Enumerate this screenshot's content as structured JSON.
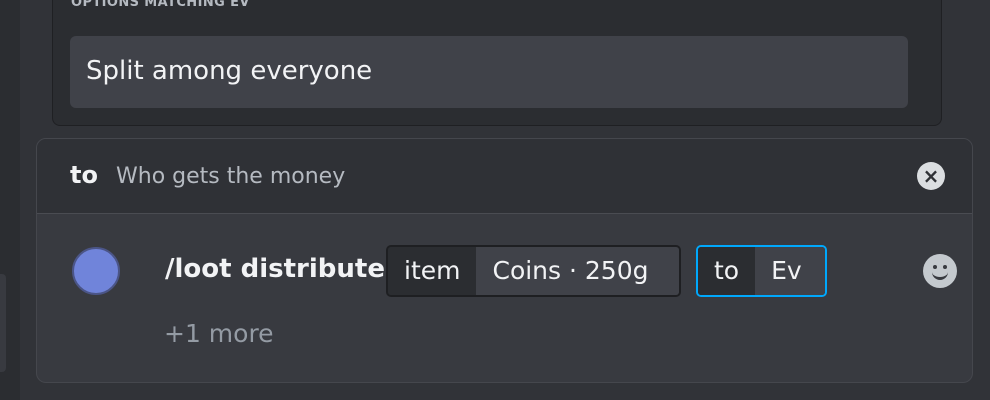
{
  "autocomplete": {
    "header": "OPTIONS MATCHING EV",
    "options": [
      {
        "label": "Split among everyone"
      }
    ]
  },
  "option_bar": {
    "name": "to",
    "description": "Who gets the money",
    "clear_icon": "close-circle-icon"
  },
  "command": {
    "name": "/loot distribute",
    "params": [
      {
        "name": "item",
        "value": "Coins · 250g",
        "focused": false
      },
      {
        "name": "to",
        "value": "Ev",
        "focused": true
      }
    ],
    "more": "+1 more"
  },
  "icons": {
    "avatar": "user-avatar",
    "emoji": "emoji-smile-icon"
  },
  "colors": {
    "focus_border": "#00a8fc",
    "avatar": "#7084da"
  }
}
